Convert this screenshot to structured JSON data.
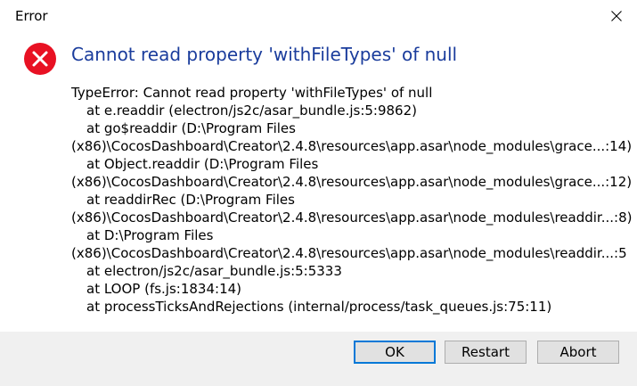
{
  "window": {
    "title": "Error"
  },
  "dialog": {
    "icon": "error-x-icon",
    "heading": "Cannot read property 'withFileTypes' of null",
    "details": [
      {
        "text": "TypeError: Cannot read property 'withFileTypes' of null",
        "indent": false
      },
      {
        "text": "at e.readdir (electron/js2c/asar_bundle.js:5:9862)",
        "indent": true
      },
      {
        "text": "at go$readdir (D:\\Program Files",
        "indent": true
      },
      {
        "text": "(x86)\\CocosDashboard\\Creator\\2.4.8\\resources\\app.asar\\node_modules\\grace...:14)",
        "indent": false
      },
      {
        "text": "at Object.readdir (D:\\Program Files",
        "indent": true
      },
      {
        "text": "(x86)\\CocosDashboard\\Creator\\2.4.8\\resources\\app.asar\\node_modules\\grace...:12)",
        "indent": false
      },
      {
        "text": "at readdirRec (D:\\Program Files",
        "indent": true
      },
      {
        "text": "(x86)\\CocosDashboard\\Creator\\2.4.8\\resources\\app.asar\\node_modules\\readdir...:8)",
        "indent": false
      },
      {
        "text": "at D:\\Program Files",
        "indent": true
      },
      {
        "text": "(x86)\\CocosDashboard\\Creator\\2.4.8\\resources\\app.asar\\node_modules\\readdir...:5",
        "indent": false
      },
      {
        "text": "at electron/js2c/asar_bundle.js:5:5333",
        "indent": true
      },
      {
        "text": "at LOOP (fs.js:1834:14)",
        "indent": true
      },
      {
        "text": "at processTicksAndRejections (internal/process/task_queues.js:75:11)",
        "indent": true
      }
    ]
  },
  "buttons": {
    "ok": "OK",
    "restart": "Restart",
    "abort": "Abort"
  },
  "colors": {
    "heading": "#1a3c9c",
    "error_icon": "#e81123",
    "default_button_border": "#0078d7",
    "footer_bg": "#f0f0f0"
  }
}
